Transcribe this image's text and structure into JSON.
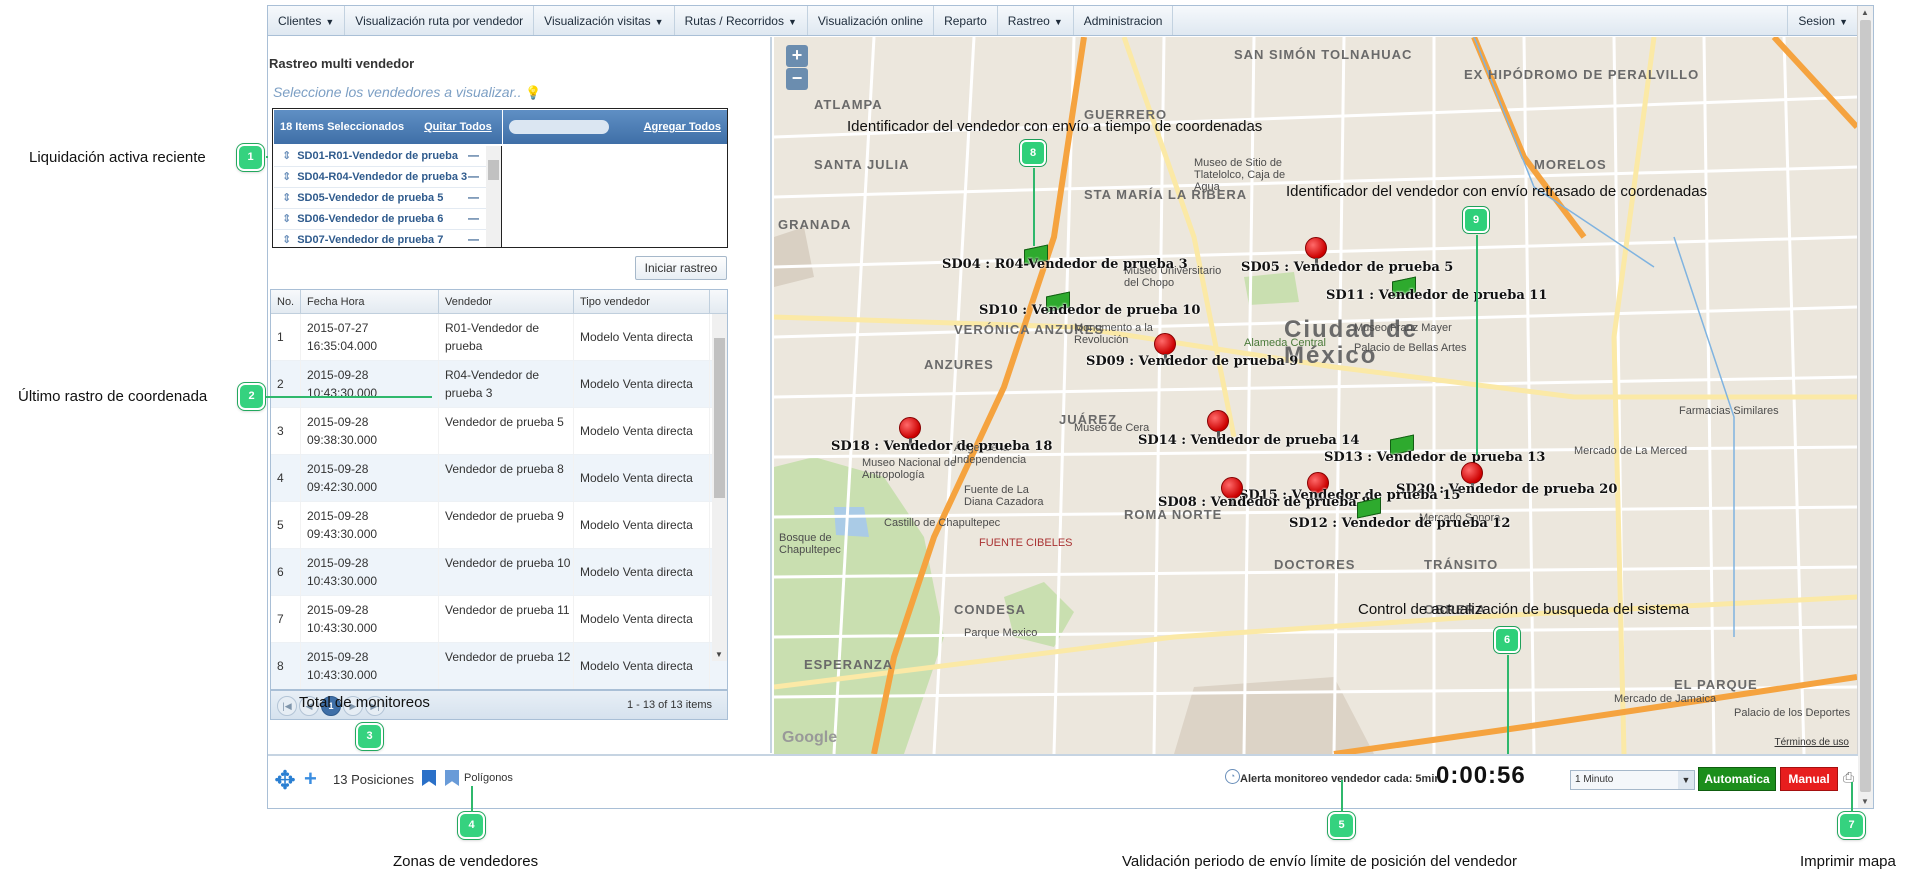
{
  "menu": {
    "items": [
      {
        "label": "Clientes",
        "caret": true
      },
      {
        "label": "Visualización ruta por vendedor",
        "caret": false
      },
      {
        "label": "Visualización visitas",
        "caret": true
      },
      {
        "label": "Rutas / Recorridos",
        "caret": true
      },
      {
        "label": "Visualización online",
        "caret": false
      },
      {
        "label": "Reparto",
        "caret": false
      },
      {
        "label": "Rastreo",
        "caret": true
      },
      {
        "label": "Administracion",
        "caret": false
      }
    ],
    "session": "Sesion"
  },
  "left_panel": {
    "title": "Rastreo multi vendedor",
    "hint": "Seleccione los vendedores a visualizar..",
    "multiselect": {
      "selected_count_label": "18 Items Seleccionados",
      "remove_all": "Quitar Todos",
      "add_all": "Agregar Todos",
      "items": [
        "SD01-R01-Vendedor de prueba",
        "SD04-R04-Vendedor de prueba 3",
        "SD05-Vendedor de prueba 5",
        "SD06-Vendedor de prueba 6",
        "SD07-Vendedor de prueba 7"
      ]
    },
    "start_button": "Iniciar rastreo",
    "grid": {
      "columns": [
        "No.",
        "Fecha Hora",
        "Vendedor",
        "Tipo vendedor"
      ],
      "rows": [
        [
          "1",
          "2015-07-27 16:35:04.000",
          "R01-Vendedor de prueba",
          "Modelo Venta directa"
        ],
        [
          "2",
          "2015-09-28 10:43:30.000",
          "R04-Vendedor de prueba 3",
          "Modelo Venta directa"
        ],
        [
          "3",
          "2015-09-28 09:38:30.000",
          "Vendedor de prueba 5",
          "Modelo Venta directa"
        ],
        [
          "4",
          "2015-09-28 09:42:30.000",
          "Vendedor de prueba 8",
          "Modelo Venta directa"
        ],
        [
          "5",
          "2015-09-28 09:43:30.000",
          "Vendedor de prueba 9",
          "Modelo Venta directa"
        ],
        [
          "6",
          "2015-09-28 10:43:30.000",
          "Vendedor de prueba 10",
          "Modelo Venta directa"
        ],
        [
          "7",
          "2015-09-28 10:43:30.000",
          "Vendedor de prueba 11",
          "Modelo Venta directa"
        ],
        [
          "8",
          "2015-09-28 10:43:30.000",
          "Vendedor de prueba 12",
          "Modelo Venta directa"
        ]
      ]
    },
    "pager": {
      "current_page": "1",
      "info": "1 - 13 of 13 items"
    }
  },
  "map": {
    "zoom_in": "+",
    "zoom_out": "−",
    "city": "Ciudad de México",
    "districts": [
      "SAN SIMÓN TOLNAHUAC",
      "EX HIPÓDROMO DE PERALVILLO",
      "GUERRERO",
      "STA MARÍA LA RIBERA",
      "MORELOS",
      "VERÓNICA ANZURES",
      "ANZURES",
      "JUÁREZ",
      "ROMA NORTE",
      "DOCTORES",
      "OBRERA",
      "TRÁNSITO",
      "CONDESA",
      "ATLAMPA",
      "SANTA JULIA",
      "GRANADA",
      "ESPERANZA",
      "EL PARQUE"
    ],
    "pois": [
      "Museo de Sitio de Tlatelolco, Caja de Agua",
      "Museo Universitario del Chopo",
      "Monumento a la Revolución",
      "Museo Franz Mayer",
      "Palacio de Bellas Artes",
      "Museo de Cera",
      "Ángel de la Independencia",
      "Museo Nacional de Antropología",
      "Fuente de La Diana Cazadora",
      "Castillo de Chapultepec",
      "FUENTE CIBELES",
      "Mercado de La Merced",
      "Mercado Sonora",
      "Mercado de Jamaica",
      "Farmacias Similares",
      "Palacio de los Deportes",
      "Parque Mexico",
      "Bosque de Chapultepec",
      "Alameda Central"
    ],
    "vendors": [
      {
        "label": "SD04 : R04-Vendedor de prueba 3",
        "kind": "truck"
      },
      {
        "label": "SD10 : Vendedor de prueba 10",
        "kind": "truck"
      },
      {
        "label": "SD05 : Vendedor de prueba 5",
        "kind": "pin"
      },
      {
        "label": "SD11 : Vendedor de prueba 11",
        "kind": "truck"
      },
      {
        "label": "SD09 : Vendedor de prueba 9",
        "kind": "pin"
      },
      {
        "label": "SD14 : Vendedor de prueba 14",
        "kind": "pin"
      },
      {
        "label": "SD18 : Vendedor de prueba 18",
        "kind": "pin"
      },
      {
        "label": "SD13 : Vendedor de prueba 13",
        "kind": "truck"
      },
      {
        "label": "SD20 : Vendedor de prueba 20",
        "kind": "pin"
      },
      {
        "label": "SD15 : Vendedor de prueba 15",
        "kind": "pin"
      },
      {
        "label": "SD08 : Vendedor de prueba 8",
        "kind": "pin"
      },
      {
        "label": "SD12 : Vendedor de prueba 12",
        "kind": "truck"
      }
    ],
    "annotations": {
      "timely": "Identificador del vendedor con envío a tiempo de coordenadas",
      "delayed": "Identificador del vendedor con envío retrasado de coordenadas",
      "refresh": "Control de actualización de busqueda del sistema"
    },
    "attribution": "Google",
    "terms": "Términos de uso"
  },
  "toolbar": {
    "positions": "13 Posiciones",
    "polygons": "Polígonos",
    "alert": "Alerta monitoreo vendedor cada: 5min.",
    "timer": "0:00:56",
    "interval": "1 Minuto",
    "auto": "Automatica",
    "manual": "Manual"
  },
  "callouts": {
    "c1": "Liquidación activa reciente",
    "c2": "Último rastro de coordenada",
    "c3": "Total de monitoreos",
    "c4": "Zonas de vendedores",
    "c5": "Validación periodo de envío límite de posición del vendedor",
    "c7": "Imprimir mapa",
    "badges": [
      "1",
      "2",
      "3",
      "4",
      "5",
      "6",
      "7",
      "8",
      "9"
    ]
  },
  "colors": {
    "accent": "#3f6fa7",
    "badge": "#35d27f",
    "auto": "#1c8e1c",
    "manual": "#e71e1e"
  }
}
